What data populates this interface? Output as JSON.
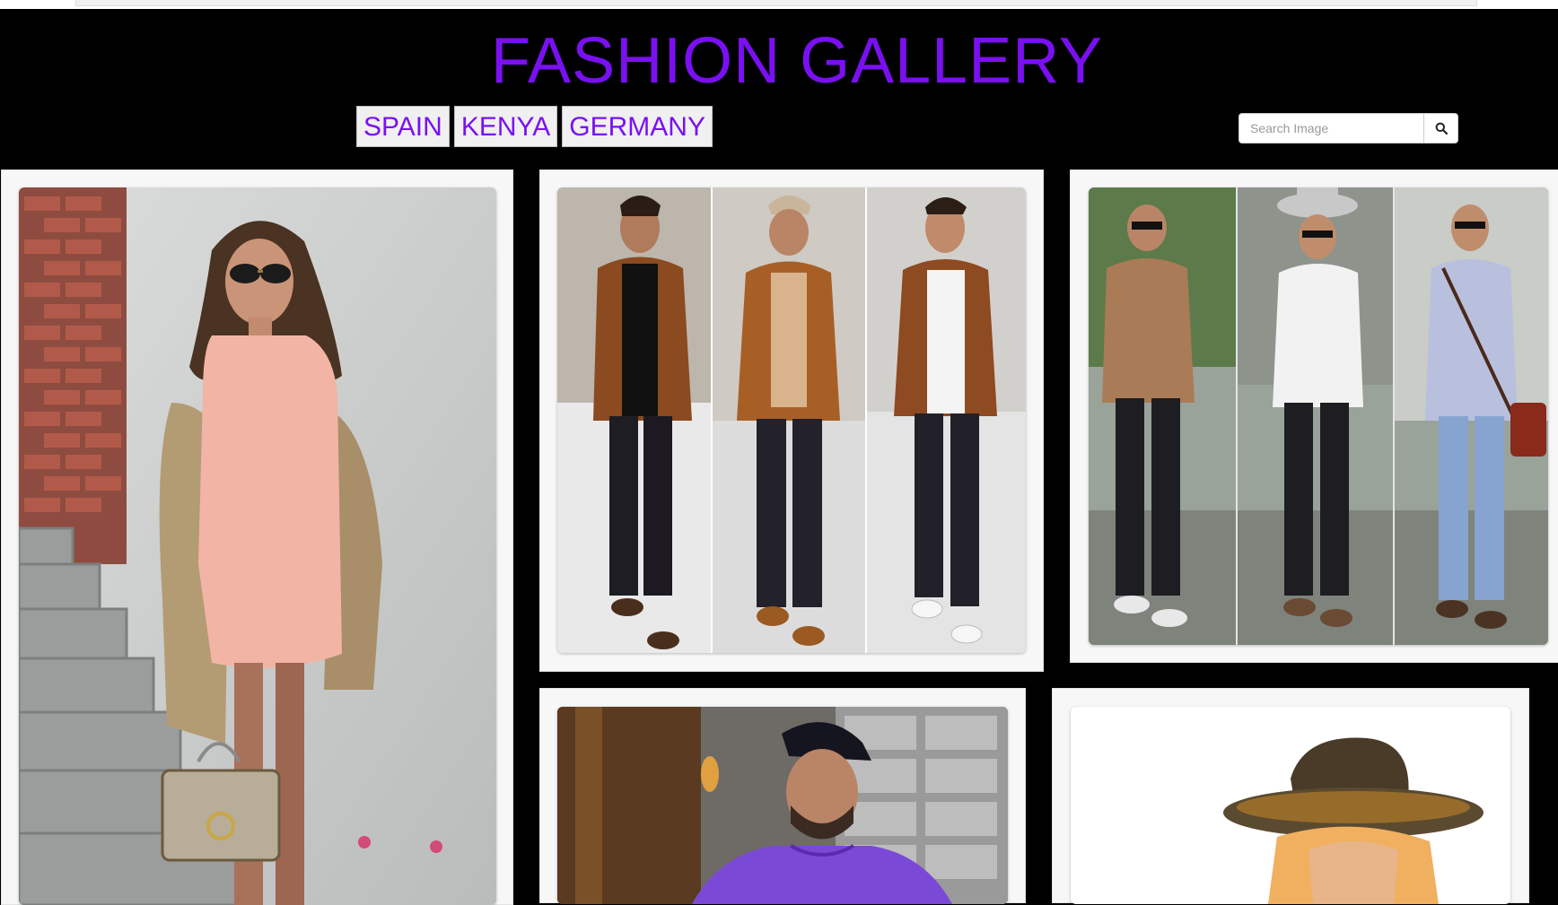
{
  "header": {
    "title": "FASHION GALLERY"
  },
  "nav": {
    "items": [
      {
        "label": "SPAIN"
      },
      {
        "label": "KENYA"
      },
      {
        "label": "GERMANY"
      }
    ]
  },
  "search": {
    "placeholder": "Search Image",
    "value": "",
    "icon": "search-icon"
  },
  "colors": {
    "accent": "#7a10f2",
    "background": "#000000",
    "card": "#f7f7f7"
  },
  "gallery": {
    "images": [
      {
        "name": "woman-pink-dress-photo"
      },
      {
        "name": "three-men-brown-jackets-photo"
      },
      {
        "name": "three-men-street-style-photo"
      },
      {
        "name": "man-purple-tee-cap-photo"
      },
      {
        "name": "woman-brown-hat-photo"
      }
    ]
  }
}
